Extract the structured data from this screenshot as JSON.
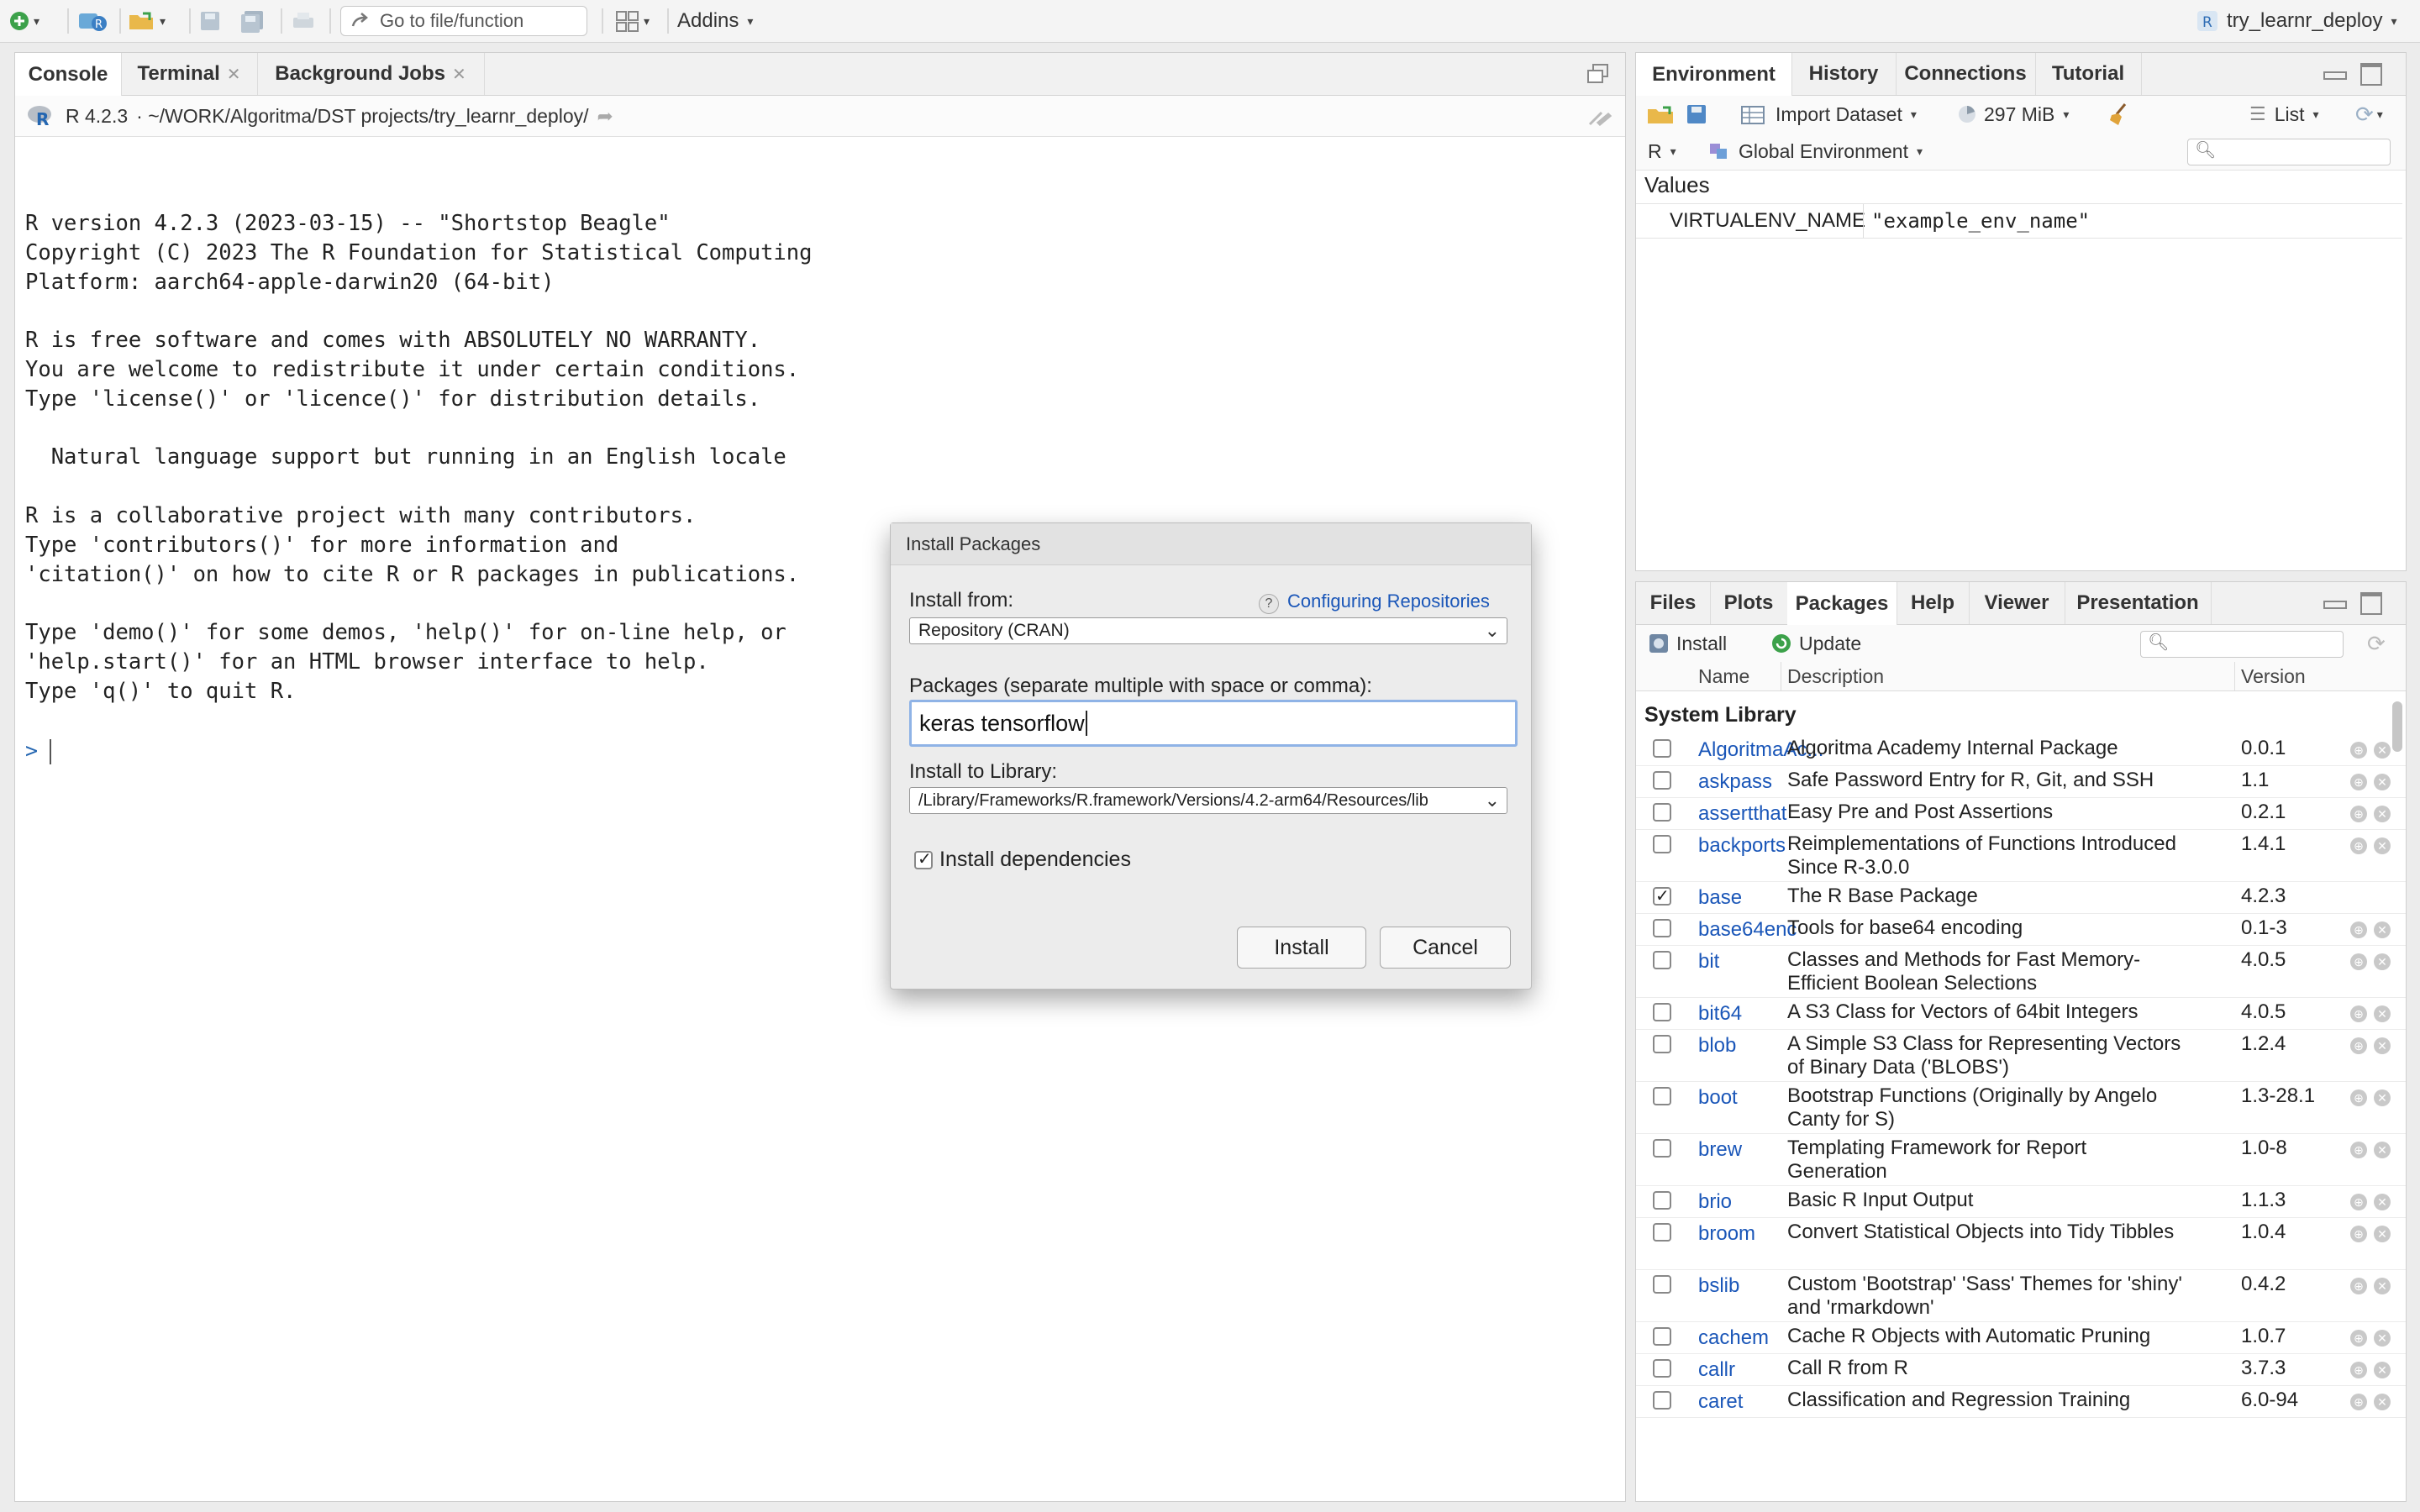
{
  "toolbar": {
    "goto_placeholder": "Go to file/function",
    "addins": "Addins",
    "project": "try_learnr_deploy"
  },
  "console": {
    "tabs": [
      "Console",
      "Terminal",
      "Background Jobs"
    ],
    "r_version": "R 4.2.3",
    "path": "· ~/WORK/Algoritma/DST projects/try_learnr_deploy/",
    "output": "R version 4.2.3 (2023-03-15) -- \"Shortstop Beagle\"\nCopyright (C) 2023 The R Foundation for Statistical Computing\nPlatform: aarch64-apple-darwin20 (64-bit)\n\nR is free software and comes with ABSOLUTELY NO WARRANTY.\nYou are welcome to redistribute it under certain conditions.\nType 'license()' or 'licence()' for distribution details.\n\n  Natural language support but running in an English locale\n\nR is a collaborative project with many contributors.\nType 'contributors()' for more information and\n'citation()' on how to cite R or R packages in publications.\n\nType 'demo()' for some demos, 'help()' for on-line help, or\n'help.start()' for an HTML browser interface to help.\nType 'q()' to quit R.",
    "prompt": ">"
  },
  "env": {
    "tabs": [
      "Environment",
      "History",
      "Connections",
      "Tutorial"
    ],
    "import_dataset": "Import Dataset",
    "memory": "297 MiB",
    "list_view": "List",
    "language": "R",
    "scope": "Global Environment",
    "section": "Values",
    "variables": [
      {
        "name": "VIRTUALENV_NAME",
        "value": "\"example_env_name\""
      }
    ]
  },
  "files": {
    "tabs": [
      "Files",
      "Plots",
      "Packages",
      "Help",
      "Viewer",
      "Presentation"
    ],
    "install": "Install",
    "update": "Update",
    "columns": {
      "name": "Name",
      "description": "Description",
      "version": "Version"
    },
    "section": "System Library",
    "packages": [
      {
        "name": "AlgoritmaAc...",
        "desc": "Algoritma Academy Internal Package",
        "ver": "0.0.1",
        "checked": false
      },
      {
        "name": "askpass",
        "desc": "Safe Password Entry for R, Git, and SSH",
        "ver": "1.1",
        "checked": false
      },
      {
        "name": "assertthat",
        "desc": "Easy Pre and Post Assertions",
        "ver": "0.2.1",
        "checked": false
      },
      {
        "name": "backports",
        "desc": "Reimplementations of Functions Introduced Since R-3.0.0",
        "ver": "1.4.1",
        "checked": false
      },
      {
        "name": "base",
        "desc": "The R Base Package",
        "ver": "4.2.3",
        "checked": true
      },
      {
        "name": "base64enc",
        "desc": "Tools for base64 encoding",
        "ver": "0.1-3",
        "checked": false
      },
      {
        "name": "bit",
        "desc": "Classes and Methods for Fast Memory-Efficient Boolean Selections",
        "ver": "4.0.5",
        "checked": false
      },
      {
        "name": "bit64",
        "desc": "A S3 Class for Vectors of 64bit Integers",
        "ver": "4.0.5",
        "checked": false
      },
      {
        "name": "blob",
        "desc": "A Simple S3 Class for Representing Vectors of Binary Data ('BLOBS')",
        "ver": "1.2.4",
        "checked": false
      },
      {
        "name": "boot",
        "desc": "Bootstrap Functions (Originally by Angelo Canty for S)",
        "ver": "1.3-28.1",
        "checked": false
      },
      {
        "name": "brew",
        "desc": "Templating Framework for Report Generation",
        "ver": "1.0-8",
        "checked": false
      },
      {
        "name": "brio",
        "desc": "Basic R Input Output",
        "ver": "1.1.3",
        "checked": false
      },
      {
        "name": "broom",
        "desc": "Convert Statistical Objects into Tidy Tibbles",
        "ver": "1.0.4",
        "checked": false
      },
      {
        "name": "bslib",
        "desc": "Custom 'Bootstrap' 'Sass' Themes for 'shiny' and 'rmarkdown'",
        "ver": "0.4.2",
        "checked": false
      },
      {
        "name": "cachem",
        "desc": "Cache R Objects with Automatic Pruning",
        "ver": "1.0.7",
        "checked": false
      },
      {
        "name": "callr",
        "desc": "Call R from R",
        "ver": "3.7.3",
        "checked": false
      },
      {
        "name": "caret",
        "desc": "Classification and Regression Training",
        "ver": "6.0-94",
        "checked": false
      }
    ]
  },
  "dialog": {
    "title": "Install Packages",
    "install_from_label": "Install from:",
    "help_link": "Configuring Repositories",
    "install_from_value": "Repository (CRAN)",
    "packages_label": "Packages (separate multiple with space or comma):",
    "packages_value": "keras tensorflow",
    "library_label": "Install to Library:",
    "library_value": "/Library/Frameworks/R.framework/Versions/4.2-arm64/Resources/lib",
    "deps_label": "Install dependencies",
    "deps_checked": true,
    "install_button": "Install",
    "cancel_button": "Cancel"
  }
}
